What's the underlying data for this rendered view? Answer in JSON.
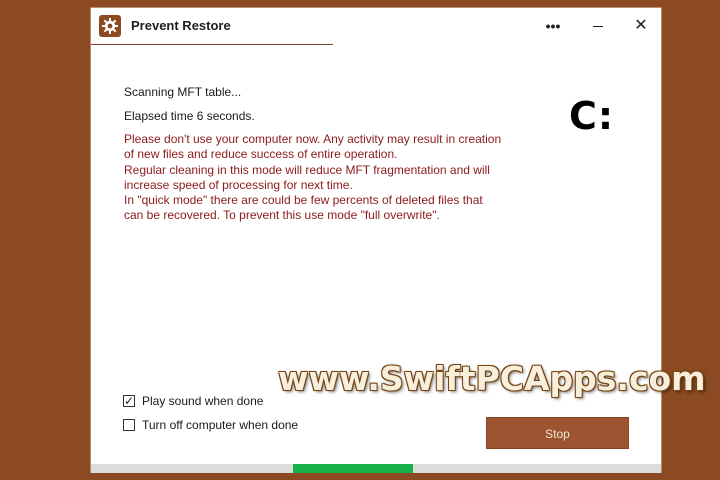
{
  "window": {
    "title": "Prevent Restore",
    "more_glyph": "•••",
    "minimize_label": "",
    "close_glyph": "✕"
  },
  "scan": {
    "status": "Scanning MFT table...",
    "elapsed": "Elapsed time 6 seconds.",
    "warning": "Please don't use your computer now. Any activity may result in creation\nof new files and reduce success of entire operation.\nRegular cleaning in this mode will reduce MFT fragmentation and will\nincrease speed of processing for next time.\nIn \"quick mode\" there are could be few percents of deleted files that\ncan be recovered. To prevent this use mode \"full overwrite\".",
    "drive": "C:"
  },
  "options": {
    "play_sound": {
      "label": "Play sound when done",
      "checked": true
    },
    "turn_off": {
      "label": "Turn off computer when done",
      "checked": false
    }
  },
  "actions": {
    "stop_label": "Stop"
  },
  "progress": {
    "segment_start_fraction": 0.354,
    "segment_end_fraction": 0.565,
    "color": "#16b04a"
  },
  "colors": {
    "accent": "#8b4a22",
    "warning_text": "#8b1a1a",
    "button": "#9c5530"
  },
  "watermark": {
    "text": "www.SwiftPCApps.com"
  },
  "icons": {
    "app": "gear-icon",
    "more": "more-icon",
    "minimize": "minimize-icon",
    "close": "close-icon"
  }
}
